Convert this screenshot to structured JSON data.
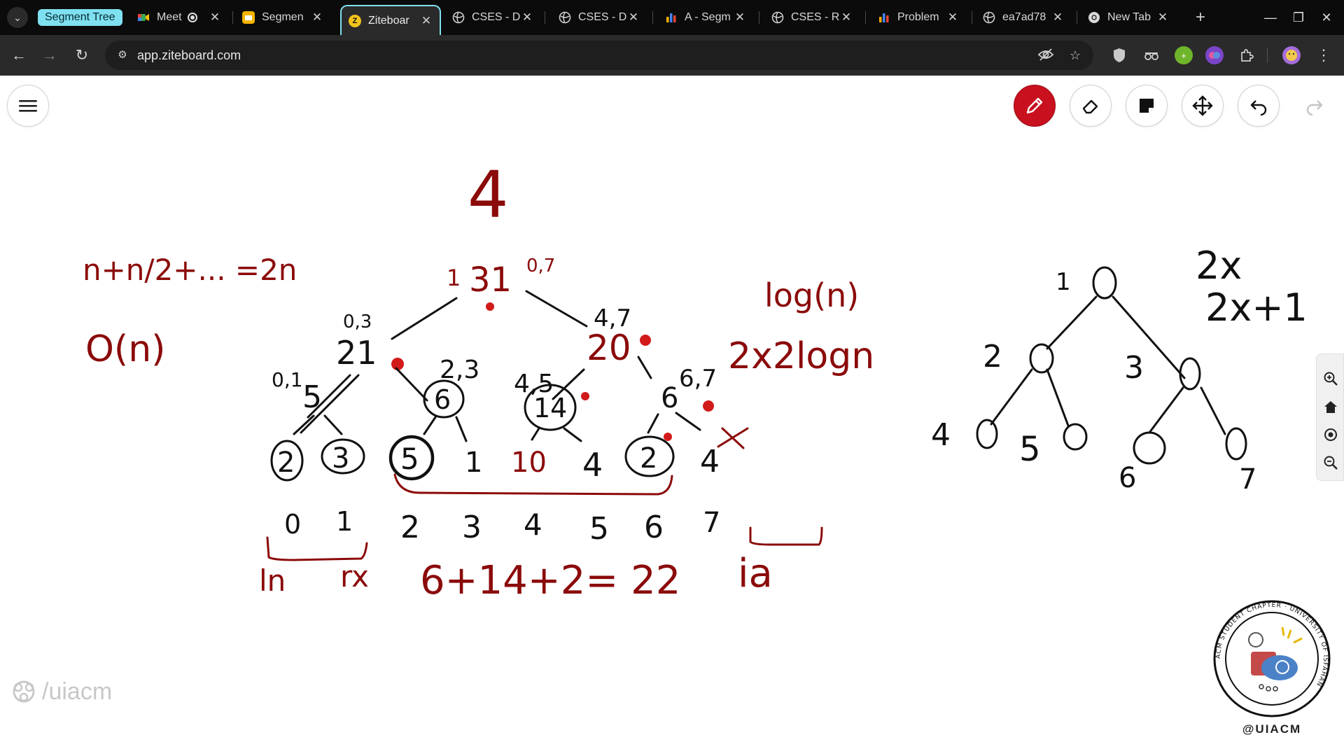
{
  "browser": {
    "group_label": "Segment Tree",
    "tabs": [
      {
        "title": "Meet",
        "favicon": "meet-icon",
        "recording": true
      },
      {
        "title": "Segmen",
        "favicon": "slides-icon"
      },
      {
        "title": "Ziteboar",
        "favicon": "ziteboard-icon",
        "active": true
      },
      {
        "title": "CSES - D",
        "favicon": "globe-icon"
      },
      {
        "title": "CSES - D",
        "favicon": "globe-icon"
      },
      {
        "title": "A - Segm",
        "favicon": "chart-icon"
      },
      {
        "title": "CSES - R",
        "favicon": "globe-icon"
      },
      {
        "title": "Problem",
        "favicon": "chart-icon"
      },
      {
        "title": "ea7ad78",
        "favicon": "globe-icon"
      },
      {
        "title": "New Tab",
        "favicon": "chrome-icon"
      }
    ],
    "url": "app.ziteboard.com"
  },
  "watermark": {
    "text": "/uiacm"
  },
  "logo": {
    "handle": "@UIACM",
    "ring_text": "ACM STUDENT CHAPTER · UNIVERSITY OF ISFAHAN"
  },
  "colors": {
    "ink_dark_red": "#8b0a0a",
    "ink_black": "#111111",
    "dot_red": "#d21a1a",
    "pen_active": "#c8101e"
  },
  "board": {
    "top_digit": "4",
    "formula_sum": "n+n/2+... =2n",
    "complexity": "O(n)",
    "log_n": "log(n)",
    "two_x_log_n": "2x2logn",
    "left_tree": {
      "root": {
        "value": "31",
        "left_index": "1",
        "range": "0,7"
      },
      "level1": [
        {
          "value": "21",
          "range": "0,3"
        },
        {
          "value": "20",
          "range": "4,7"
        }
      ],
      "level2": [
        {
          "value": "5",
          "range": "0,1"
        },
        {
          "value": "6",
          "range": "2,3"
        },
        {
          "value": "14",
          "range": "4,5"
        },
        {
          "value": "6",
          "range": "6,7"
        }
      ],
      "leaves": [
        "2",
        "3",
        "5",
        "1",
        "10",
        "4",
        "2",
        "4"
      ],
      "indices": [
        "0",
        "1",
        "2",
        "3",
        "4",
        "5",
        "6",
        "7"
      ],
      "query_label_left": "ln",
      "query_label_right": "rx",
      "sum_equation": "6+14+2= 22",
      "query_mark": "ia"
    },
    "right_tree": {
      "nodes": [
        "1",
        "2",
        "3",
        "4",
        "5",
        "6",
        "7"
      ],
      "formula_left": "2x",
      "formula_right": "2x+1"
    }
  }
}
